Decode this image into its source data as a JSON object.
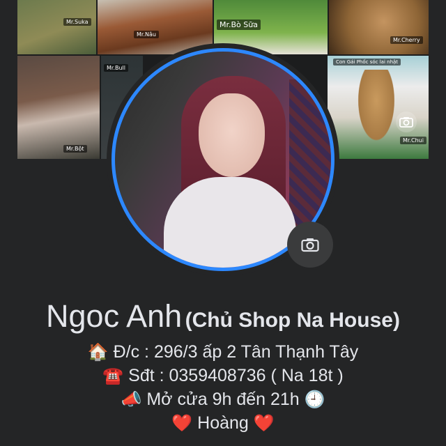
{
  "cover": {
    "tags": [
      "Mr.Suka",
      "Mr.Nâu",
      "Mr.Bò Sữa",
      "Mr.Cherry",
      "Mr.Bột",
      "Mr.Bull",
      "Con Gái Phốc sóc lai nhật",
      "Mr.Chui"
    ]
  },
  "profile": {
    "name": "Ngoc Anh",
    "nickname": "(Chủ Shop Na House)"
  },
  "bio": [
    {
      "icon": "house-icon",
      "emoji": "🏠",
      "text": "Đ/c : 296/3 ấp 2 Tân Thạnh Tây",
      "trail_emoji": ""
    },
    {
      "icon": "telephone-icon",
      "emoji": "☎️",
      "text": "Sđt : 0359408736 ( Na 18t )",
      "trail_emoji": ""
    },
    {
      "icon": "megaphone-icon",
      "emoji": "📣",
      "text": "Mở cửa 9h đến 21h",
      "trail_emoji": "🕘"
    },
    {
      "icon": "heart-icon",
      "emoji": "❤️",
      "text": "Hoàng",
      "trail_emoji": "❤️"
    }
  ],
  "colors": {
    "background": "#242526",
    "avatar_ring": "#2d88ff",
    "text": "#e4e6eb"
  }
}
